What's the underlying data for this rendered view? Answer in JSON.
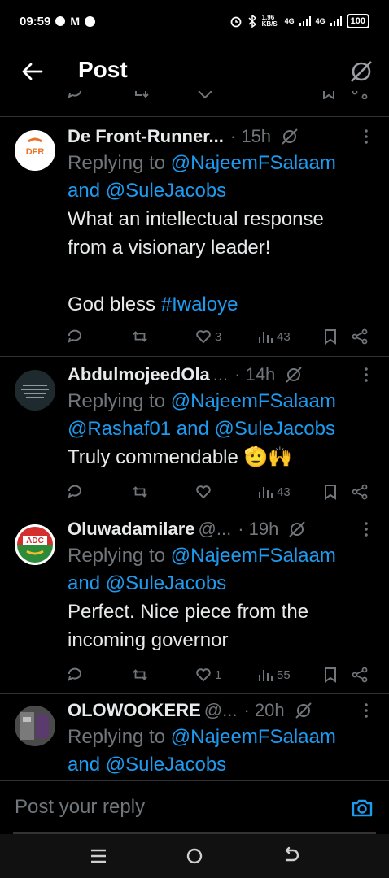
{
  "status_bar": {
    "time": "09:59",
    "speed": "1.96 KB/S",
    "net1": "4G",
    "net2": "4G",
    "battery": "100"
  },
  "header": {
    "title": "Post"
  },
  "composer": {
    "placeholder": "Post your reply"
  },
  "replies": [
    {
      "author": "De Front-Runner...",
      "handle": "",
      "time": "· 15h",
      "replying_prefix": "Replying to ",
      "mention1": "@NajeemFSalaam",
      "connector": "and ",
      "mention2": "@SuleJacobs",
      "text_line1": "What an intellectual response",
      "text_line2": "from a visionary leader!",
      "text_line3": "God bless ",
      "hashtag": "#Iwaloye",
      "likes": "3",
      "views": "43"
    },
    {
      "author": "AbdulmojeedOla",
      "handle": "...",
      "time": "· 14h",
      "replying_prefix": "Replying to ",
      "mention1": "@NajeemFSalaam",
      "mention_line2": "@Rashaf01",
      "connector": " and ",
      "mention2": "@SuleJacobs",
      "text_line1": "Truly commendable 🫡🙌",
      "likes": "",
      "views": "43"
    },
    {
      "author": "Oluwadamilare",
      "handle": "@...",
      "time": "· 19h",
      "replying_prefix": "Replying to ",
      "mention1": "@NajeemFSalaam",
      "connector": "and ",
      "mention2": "@SuleJacobs",
      "text_line1": "Perfect. Nice piece from the",
      "text_line2": "incoming governor",
      "likes": "1",
      "views": "55"
    },
    {
      "author": "OLOWOOKERE",
      "handle": "@...",
      "time": "· 20h",
      "replying_prefix": "Replying to ",
      "mention1": "@NajeemFSalaam",
      "connector": "and ",
      "mention2": "@SuleJacobs"
    }
  ],
  "avatars": {
    "r1_logo": "DFR",
    "r3_logo": "ADC"
  },
  "colors": {
    "accent": "#1d9bf0",
    "muted": "#71767b",
    "text": "#e7e9ea",
    "background": "#000000"
  }
}
